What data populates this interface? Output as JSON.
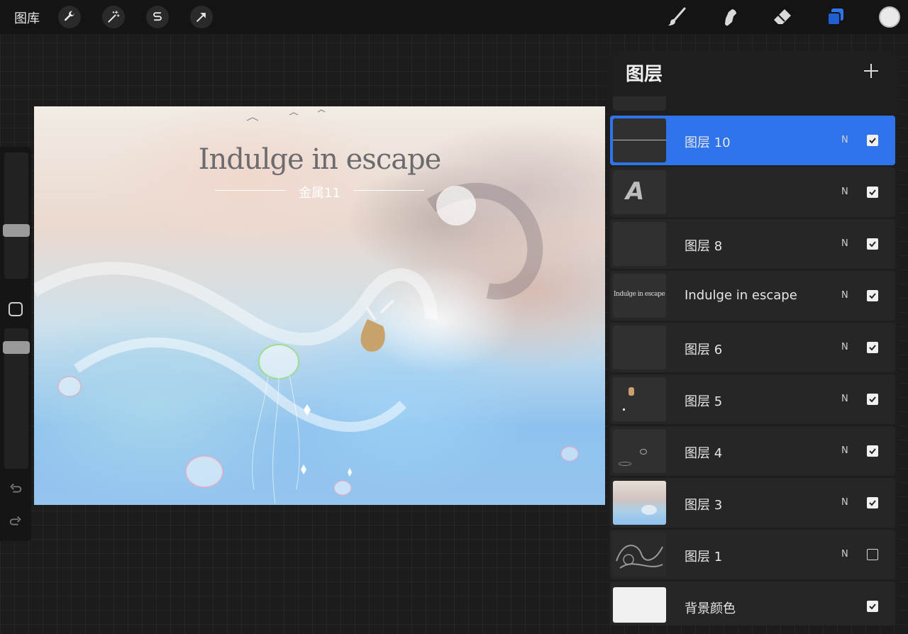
{
  "topbar": {
    "gallery_label": "图库",
    "tools_left": [
      "wrench-icon",
      "magic-wand-icon",
      "selection-s-icon",
      "transform-arrow-icon"
    ],
    "tools_right": [
      "brush-icon",
      "smudge-icon",
      "eraser-icon",
      "layers-icon"
    ],
    "active_color": "#e9e9e9"
  },
  "canvas": {
    "title": "Indulge in escape",
    "subtitle": "金属11"
  },
  "layers_panel": {
    "title": "图层",
    "layers": [
      {
        "name": "图层 10",
        "blend": "N",
        "visible": true,
        "active": true,
        "thumb": "line"
      },
      {
        "name": "",
        "blend": "N",
        "visible": true,
        "active": false,
        "thumb": "text-A"
      },
      {
        "name": "图层 8",
        "blend": "N",
        "visible": true,
        "active": false,
        "thumb": "empty"
      },
      {
        "name": "Indulge in escape",
        "blend": "N",
        "visible": true,
        "active": false,
        "thumb": "title"
      },
      {
        "name": "图层 6",
        "blend": "N",
        "visible": true,
        "active": false,
        "thumb": "empty"
      },
      {
        "name": "图层 5",
        "blend": "N",
        "visible": true,
        "active": false,
        "thumb": "figure"
      },
      {
        "name": "图层 4",
        "blend": "N",
        "visible": true,
        "active": false,
        "thumb": "jellyfish"
      },
      {
        "name": "图层 3",
        "blend": "N",
        "visible": true,
        "active": false,
        "thumb": "painting"
      },
      {
        "name": "图层 1",
        "blend": "N",
        "visible": false,
        "active": false,
        "thumb": "sketch"
      },
      {
        "name": "背景颜色",
        "blend": "",
        "visible": true,
        "active": false,
        "thumb": "background"
      }
    ],
    "thumb_title_text": "Indulge in escape",
    "thumb_A_text": "A"
  },
  "colors": {
    "accent": "#2f74ea",
    "panel": "#1e1e1e",
    "topbar": "#141414"
  }
}
